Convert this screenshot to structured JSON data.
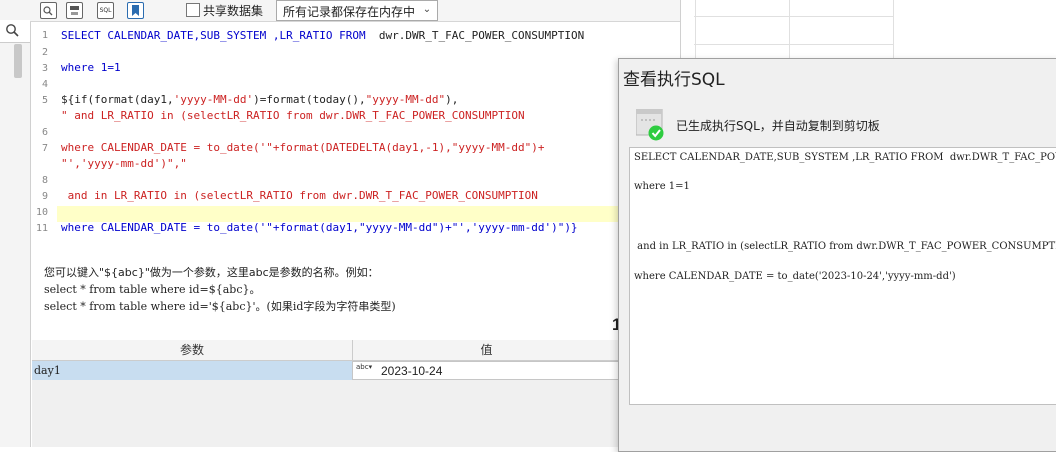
{
  "toolbar": {
    "share_label": "共享数据集",
    "cache_mode": "所有记录都保存在内存中",
    "sql_icon_text": "SQL"
  },
  "editor": {
    "line_numbers": [
      "1",
      "2",
      "3",
      "4",
      "5",
      "",
      "6",
      "7",
      "",
      "8",
      "9",
      "10",
      "11"
    ],
    "lines": [
      [
        "SELECT CALENDAR_DATE,SUB_SYSTEM ,LR_RATIO FROM  ",
        "dwr.DWR_T_FAC_POWER_CONSUMPTION"
      ],
      [
        ""
      ],
      [
        "where 1=1"
      ],
      [
        ""
      ],
      [
        "${if(format(day1,",
        "'yyyy-MM-dd'",
        ")=format(today(),",
        "\"yyyy-MM-dd\"",
        "),"
      ],
      [
        "\" and LR_RATIO in (selectLR_RATIO from dwr.DWR_T_FAC_POWER_CONSUMPTION"
      ],
      [
        ""
      ],
      [
        "where CALENDAR_DATE = to_date('\"+format(DATEDELTA(day1,-1),\"yyyy-MM-dd\")+"
      ],
      [
        "\"','yyyy-mm-dd')\",\""
      ],
      [
        ""
      ],
      [
        " and in LR_RATIO in (selectLR_RATIO from dwr.DWR_T_FAC_POWER_CONSUMPTION"
      ],
      [
        ""
      ],
      [
        "where CALENDAR_DATE = to_date('\"+format(day1,\"yyyy-MM-dd\")+\"','yyyy-mm-dd')\")}"
      ]
    ]
  },
  "hint": {
    "line1": "您可以键入\"${abc}\"做为一个参数，这里abc是参数的名称。例如：",
    "line2": "select * from table where id=${abc}。",
    "line3": "select * from table where id='${abc}'。(如果id字段为字符串类型)"
  },
  "params": {
    "col_name": "参数",
    "col_value": "值",
    "rows": [
      {
        "name": "day1",
        "value": "2023-10-24"
      }
    ],
    "type_icon": "abc"
  },
  "badge": "1",
  "dialog": {
    "title": "查看执行SQL",
    "message": "已生成执行SQL，并自动复制到剪切板",
    "sql_lines": [
      "SELECT CALENDAR_DATE,SUB_SYSTEM ,LR_RATIO FROM  dwr.DWR_T_FAC_POWER_CONSUMPTION",
      "",
      "where 1=1",
      "",
      "",
      "",
      " and in LR_RATIO in (selectLR_RATIO from dwr.DWR_T_FAC_POWER_CONSUMPTION",
      "",
      "where CALENDAR_DATE = to_date('2023-10-24','yyyy-mm-dd')"
    ]
  },
  "colors": {
    "keyword": "#0000cc",
    "string": "#cc2222",
    "highlight": "#ffffc8",
    "selected_row": "#c8ddf0",
    "success": "#2ecc40"
  }
}
